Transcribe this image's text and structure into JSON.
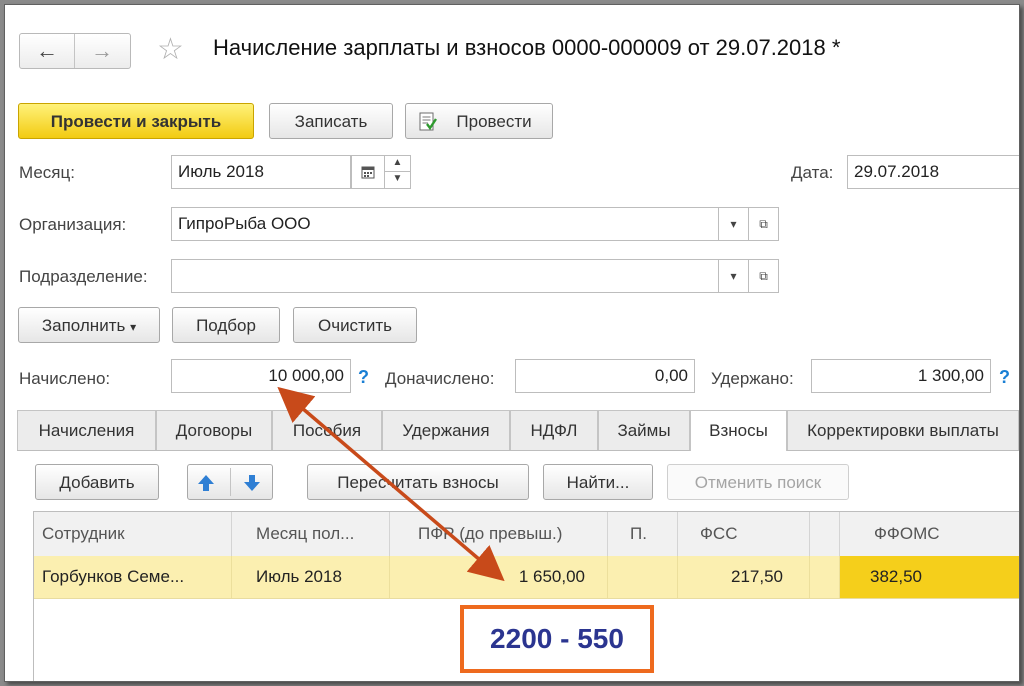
{
  "header": {
    "back_glyph": "←",
    "forward_glyph": "→",
    "star_glyph": "☆",
    "title": "Начисление зарплаты и взносов 0000-000009 от 29.07.2018 *"
  },
  "toolbar": {
    "post_close": "Провести и закрыть",
    "save": "Записать",
    "post": "Провести"
  },
  "form": {
    "month_label": "Месяц:",
    "month_value": "Июль 2018",
    "date_label": "Дата:",
    "date_value": "29.07.2018",
    "org_label": "Организация:",
    "org_value": "ГипроРыба ООО",
    "dept_label": "Подразделение:",
    "dept_value": ""
  },
  "actions": {
    "fill": "Заполнить",
    "select": "Подбор",
    "clear": "Очистить"
  },
  "totals": {
    "accrued_label": "Начислено:",
    "accrued_value": "10 000,00",
    "extra_label": "Доначислено:",
    "extra_value": "0,00",
    "withheld_label": "Удержано:",
    "withheld_value": "1 300,00",
    "help": "?"
  },
  "tabs": [
    {
      "label": "Начисления"
    },
    {
      "label": "Договоры"
    },
    {
      "label": "Пособия"
    },
    {
      "label": "Удержания"
    },
    {
      "label": "НДФЛ"
    },
    {
      "label": "Займы"
    },
    {
      "label": "Взносы"
    },
    {
      "label": "Корректировки выплаты"
    }
  ],
  "active_tab": "Взносы",
  "grid_toolbar": {
    "add": "Добавить",
    "recalc": "Пересчитать взносы",
    "find": "Найти...",
    "cancel_search": "Отменить поиск"
  },
  "table": {
    "columns": [
      "Сотрудник",
      "Месяц пол...",
      "ПФР (до превыш.)",
      "П.",
      "ФСС",
      "",
      "ФФОМС"
    ],
    "rows": [
      {
        "employee": "Горбунков Семе...",
        "month": "Июль 2018",
        "pfr": "1 650,00",
        "p": "",
        "fss": "217,50",
        "x": "",
        "ffoms": "382,50"
      }
    ]
  },
  "annotation": {
    "text": "2200 - 550",
    "arrow_color": "#c84a1a",
    "box_color": "#ee6a1e"
  }
}
